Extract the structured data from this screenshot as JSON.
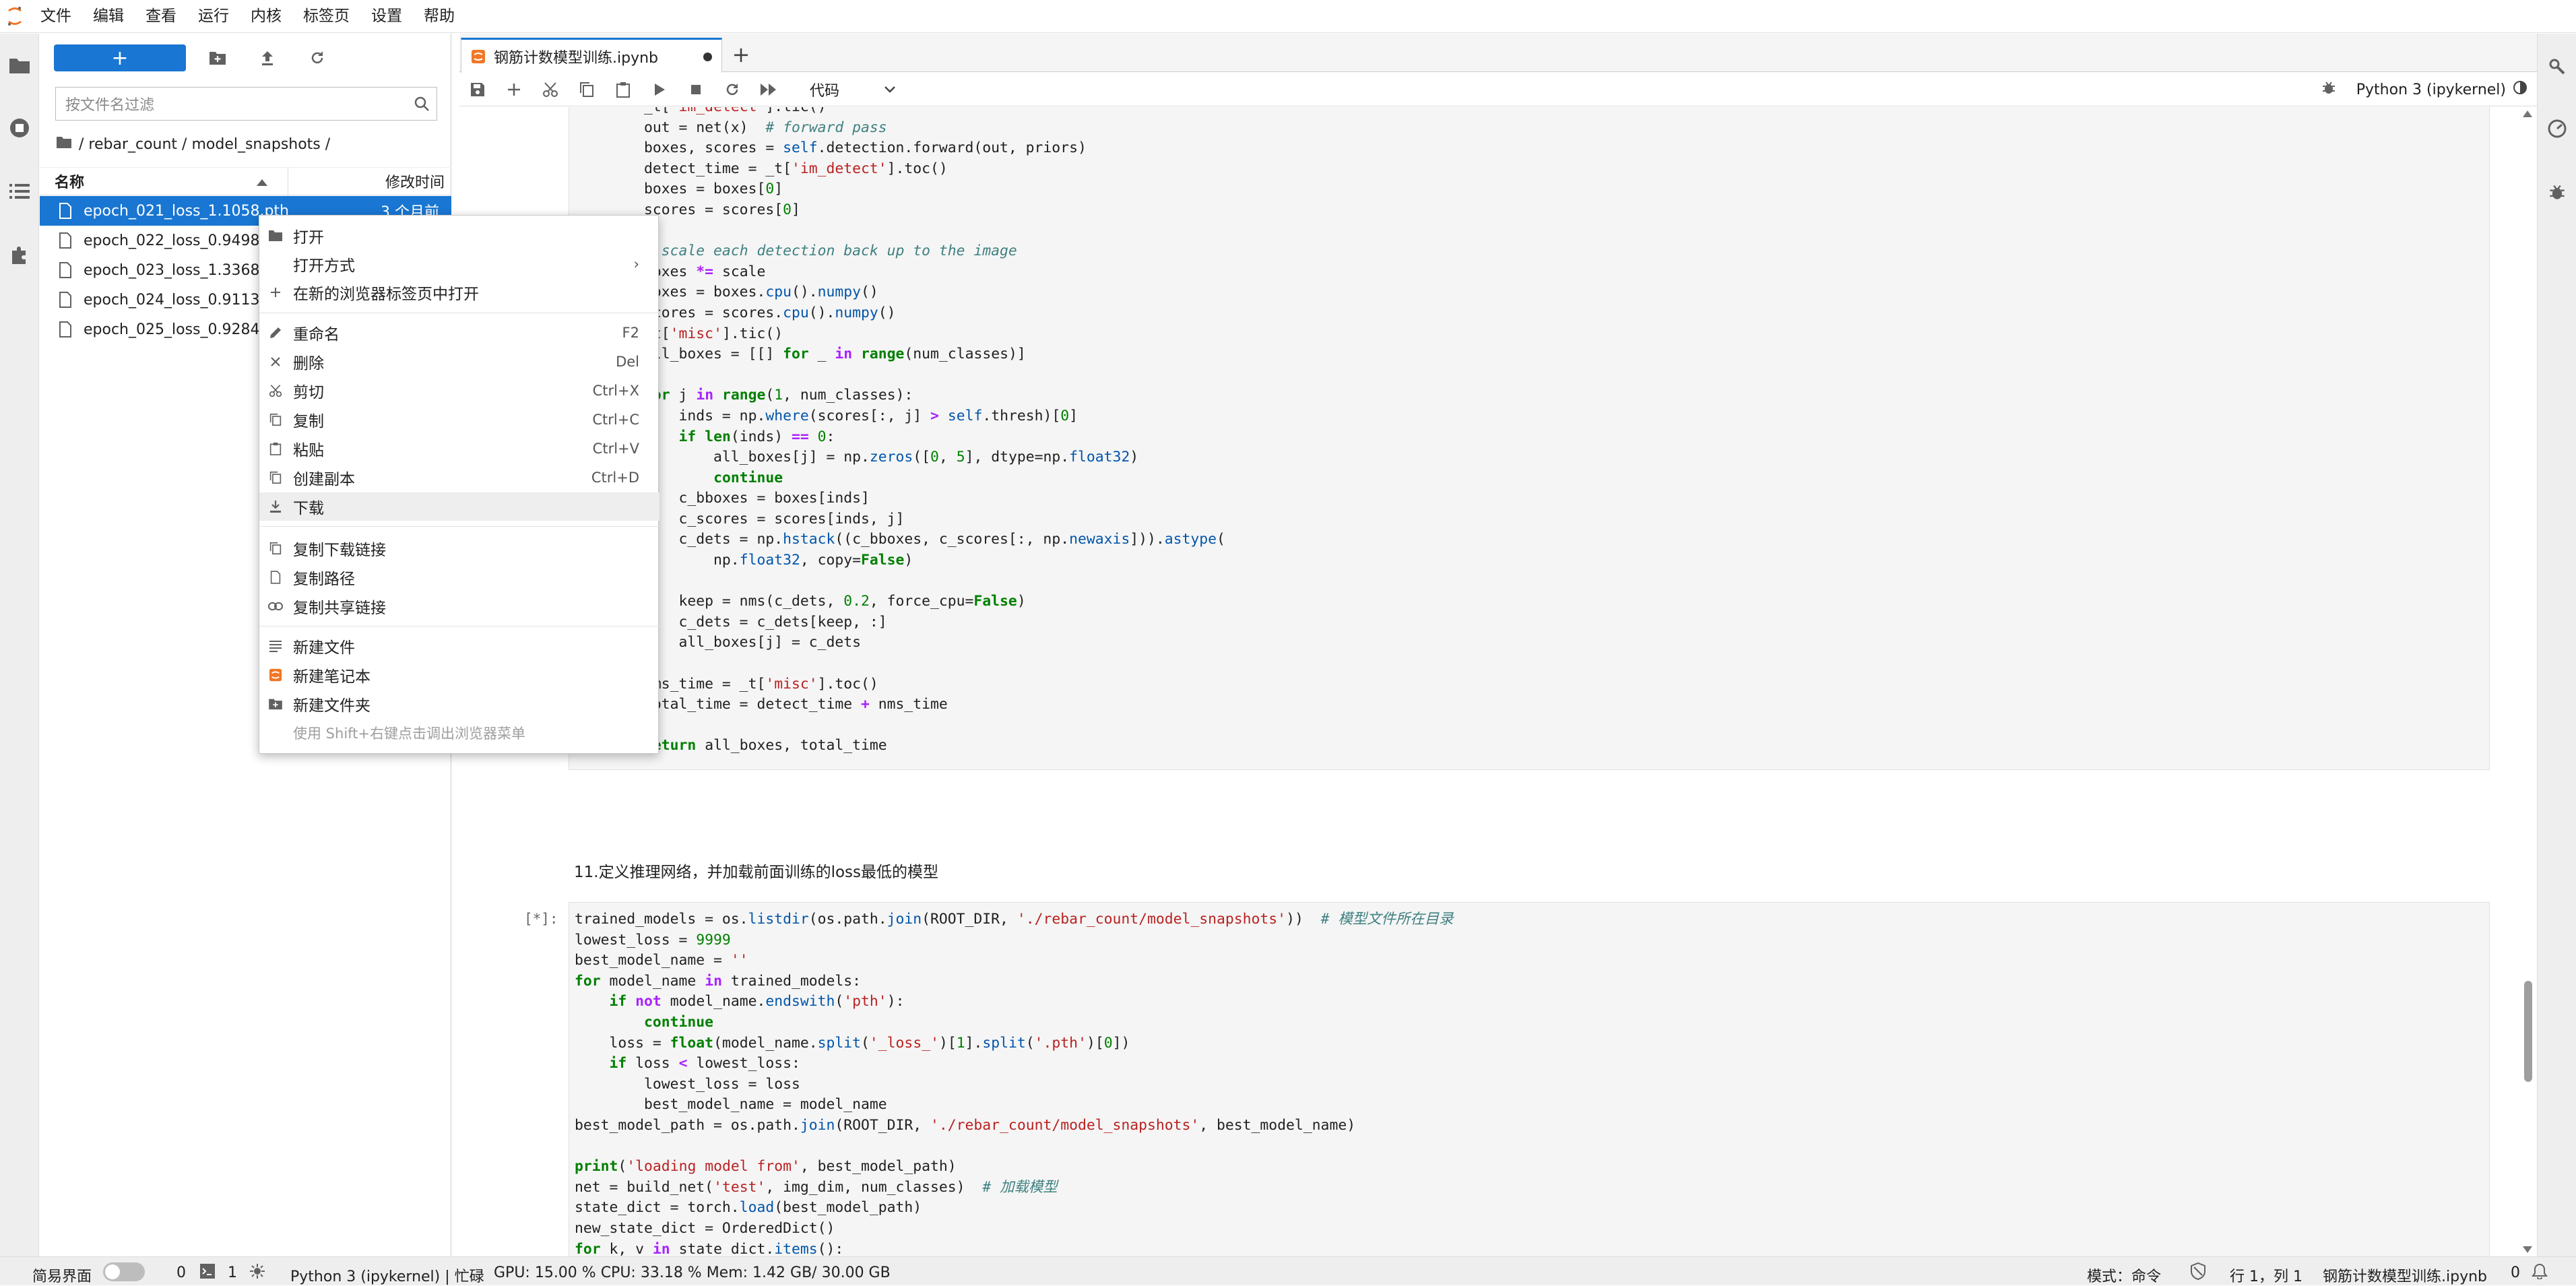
{
  "menubar": {
    "items": [
      "文件",
      "编辑",
      "查看",
      "运行",
      "内核",
      "标签页",
      "设置",
      "帮助"
    ]
  },
  "file_browser": {
    "filter_placeholder": "按文件名过滤",
    "breadcrumb": "/ rebar_count / model_snapshots /",
    "col_name": "名称",
    "col_modified": "修改时间",
    "files": [
      {
        "name": "epoch_021_loss_1.1058.pth",
        "modified": "3 个月前"
      },
      {
        "name": "epoch_022_loss_0.9498.pth",
        "modified": ""
      },
      {
        "name": "epoch_023_loss_1.3368.pth",
        "modified": ""
      },
      {
        "name": "epoch_024_loss_0.9113.pth",
        "modified": ""
      },
      {
        "name": "epoch_025_loss_0.9284.pth",
        "modified": ""
      }
    ]
  },
  "context_menu": {
    "open": "打开",
    "open_with": "打开方式",
    "open_browser_tab": "在新的浏览器标签页中打开",
    "rename": "重命名",
    "rename_key": "F2",
    "delete": "删除",
    "delete_key": "Del",
    "cut": "剪切",
    "cut_key": "Ctrl+X",
    "copy": "复制",
    "copy_key": "Ctrl+C",
    "paste": "粘贴",
    "paste_key": "Ctrl+V",
    "duplicate": "创建副本",
    "duplicate_key": "Ctrl+D",
    "download": "下载",
    "copy_download_link": "复制下载链接",
    "copy_path": "复制路径",
    "copy_shareable_link": "复制共享链接",
    "new_file": "新建文件",
    "new_notebook": "新建笔记本",
    "new_folder": "新建文件夹",
    "hint": "使用 Shift+右键点击调出浏览器菜单"
  },
  "notebook": {
    "tab_title": "钢筋计数模型训练.ipynb",
    "cell_type": "代码",
    "kernel_name": "Python 3 (ipykernel)",
    "markdown": "11.定义推理网络，并加载前面训练的loss最低的模型",
    "prompt": "[*]:"
  },
  "statusbar": {
    "simple_mode": "简易界面",
    "terminals": "0",
    "kernels": "1",
    "kernel_status": "Python 3 (ipykernel) | 忙碌",
    "resources": "GPU: 15.00 % CPU: 33.18 % Mem: 1.42 GB/ 30.00 GB",
    "mode": "模式：命令",
    "position": "行 1，列 1",
    "file": "钢筋计数模型训练.ipynb",
    "notifications": "0"
  },
  "colors": {
    "accent": "#1976d2",
    "selection": "#1976d2",
    "notebook_icon": "#f37626"
  }
}
